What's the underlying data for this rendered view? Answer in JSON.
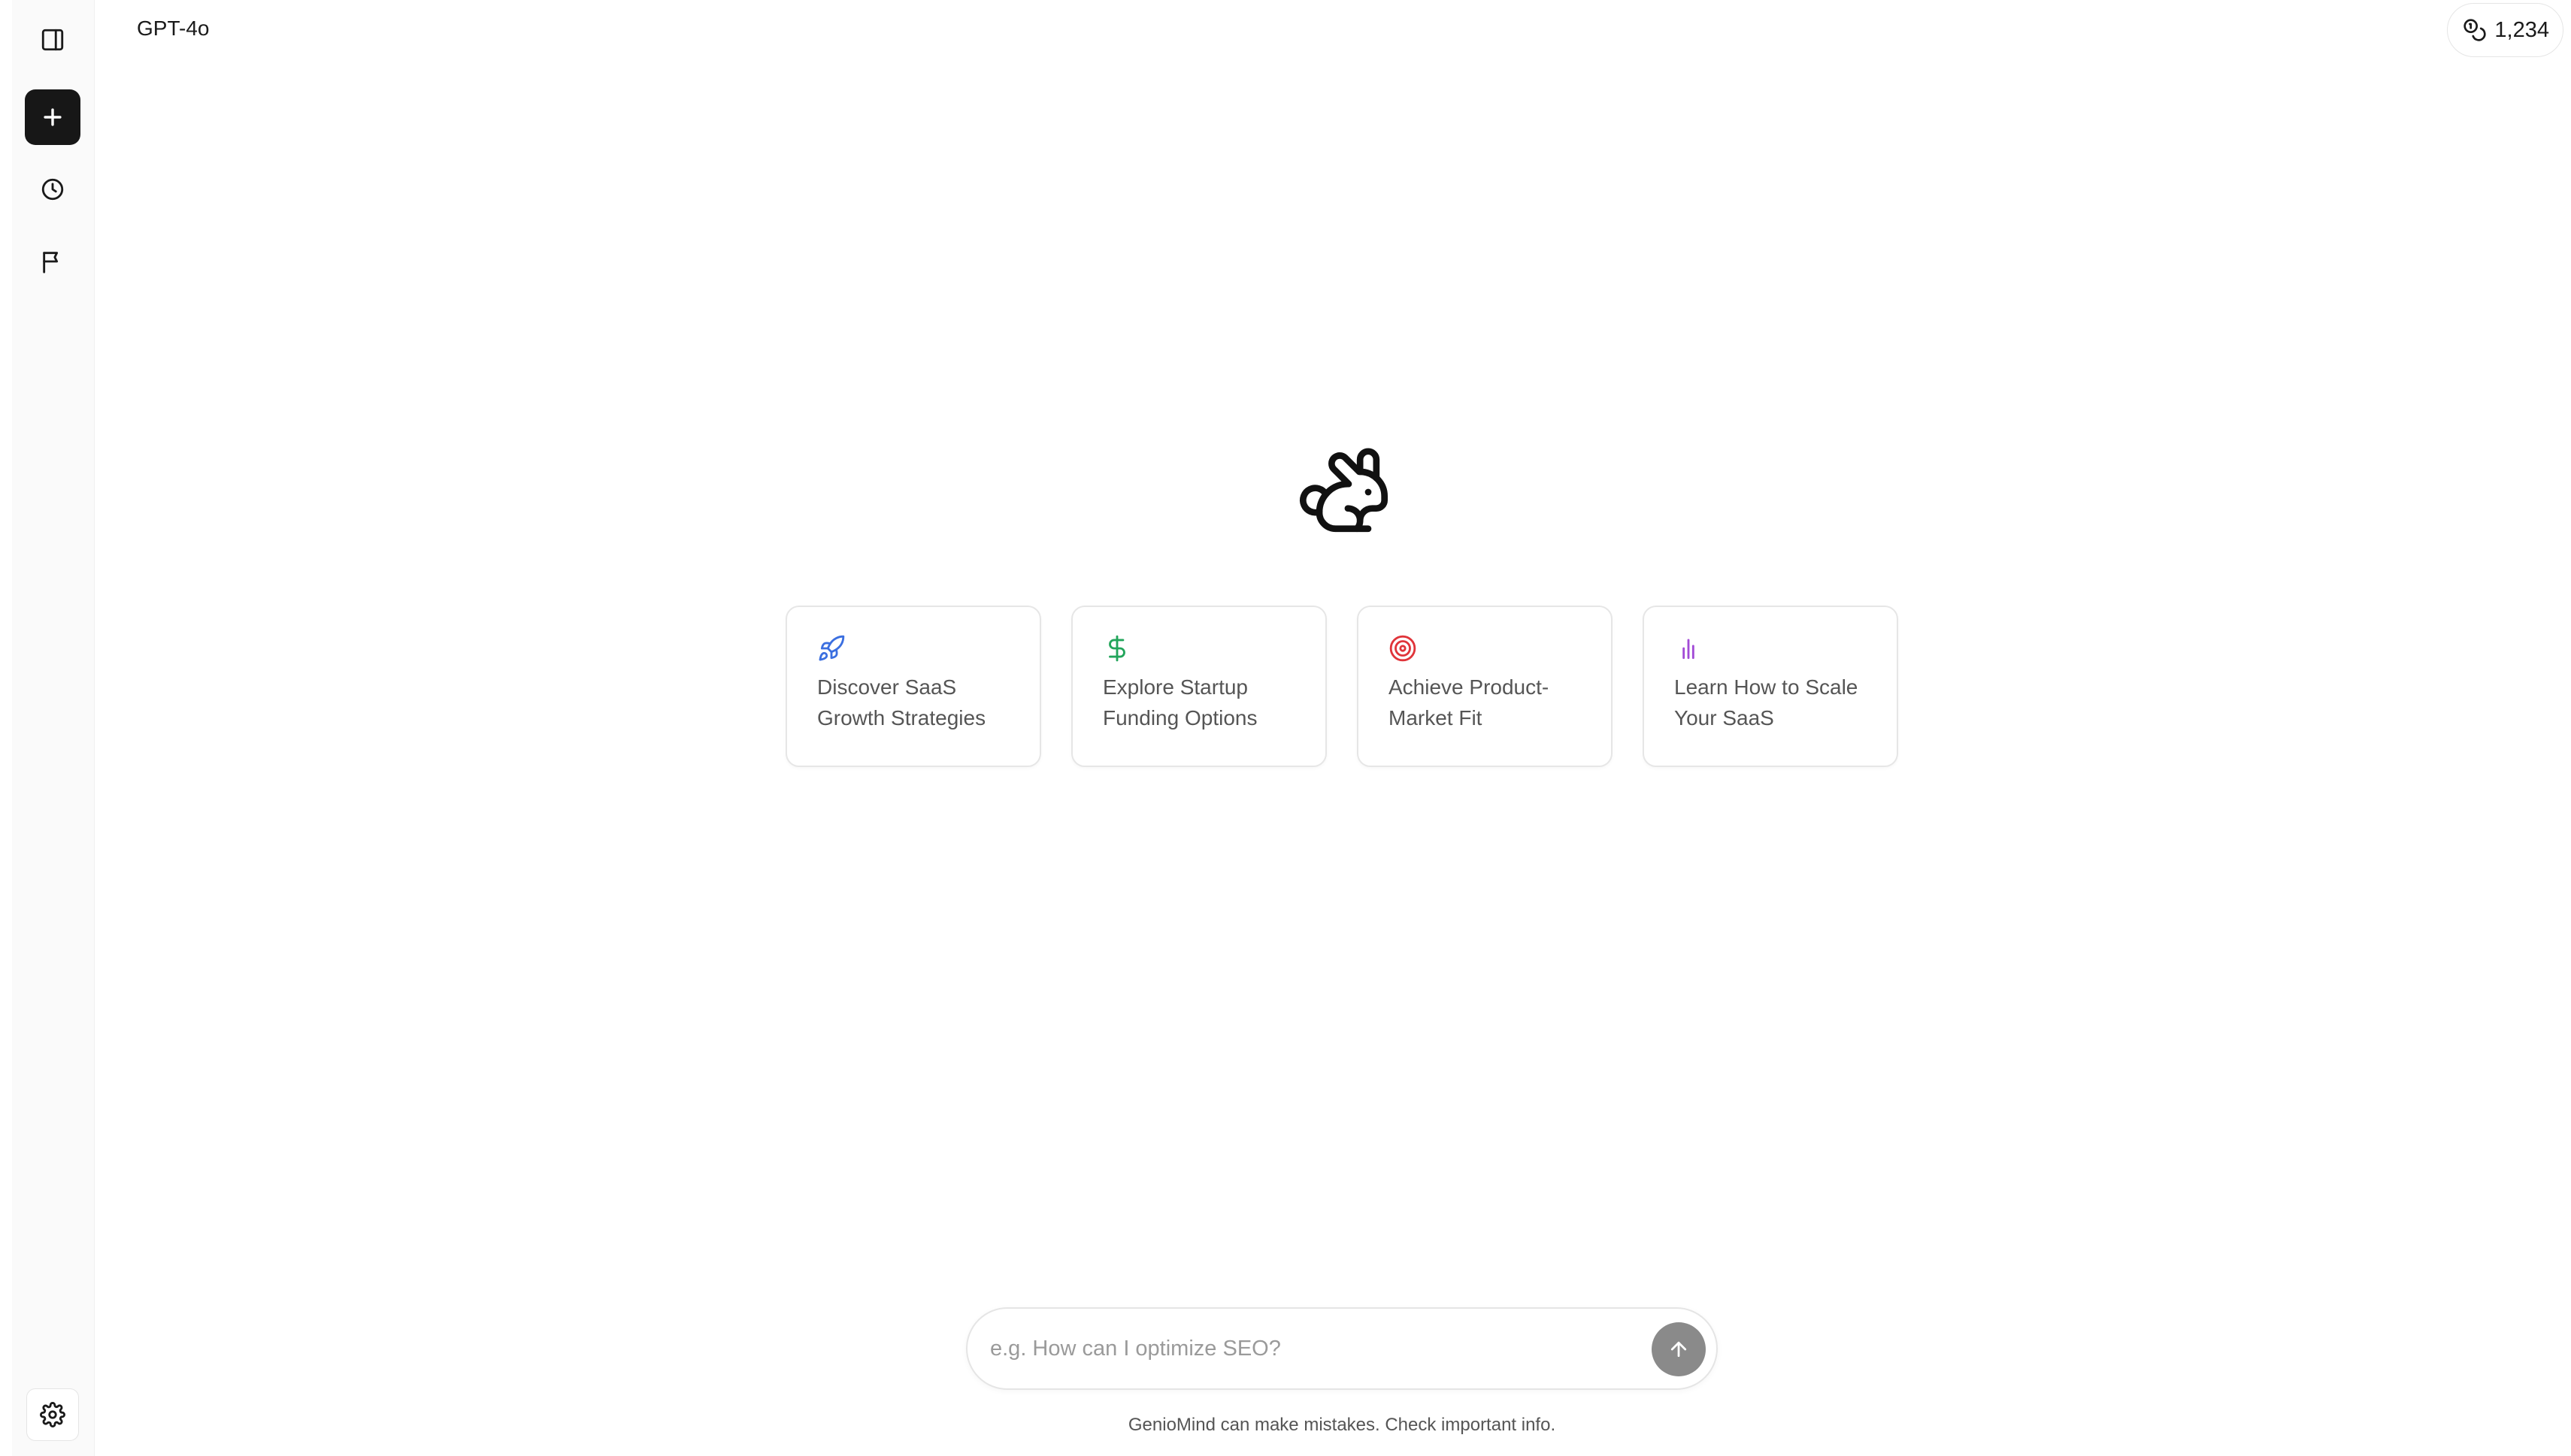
{
  "sidebar": {
    "items": [
      {
        "icon": "sidebar-panel-icon"
      },
      {
        "icon": "plus-icon"
      },
      {
        "icon": "clock-icon"
      },
      {
        "icon": "flag-icon"
      }
    ],
    "settings_icon": "gear-icon"
  },
  "header": {
    "model": "GPT-4o",
    "credits_icon": "coins-icon",
    "credits": "1,234"
  },
  "main": {
    "logo_icon": "rabbit-icon",
    "suggestions": [
      {
        "icon": "rocket-icon",
        "color": "#3b6fe0",
        "text": "Discover SaaS\nGrowth Strategies"
      },
      {
        "icon": "dollar-icon",
        "color": "#22a55b",
        "text": "Explore Startup\nFunding Options"
      },
      {
        "icon": "target-icon",
        "color": "#e0343a",
        "text": "Achieve Product-\nMarket Fit"
      },
      {
        "icon": "bar-chart-icon",
        "color": "#a24bd6",
        "text": "Learn How to Scale\nYour SaaS"
      }
    ]
  },
  "composer": {
    "placeholder": "e.g. How can I optimize SEO?",
    "value": "",
    "send_icon": "arrow-up-icon"
  },
  "footer": {
    "disclaimer": "GenioMind can make mistakes. Check important info."
  }
}
